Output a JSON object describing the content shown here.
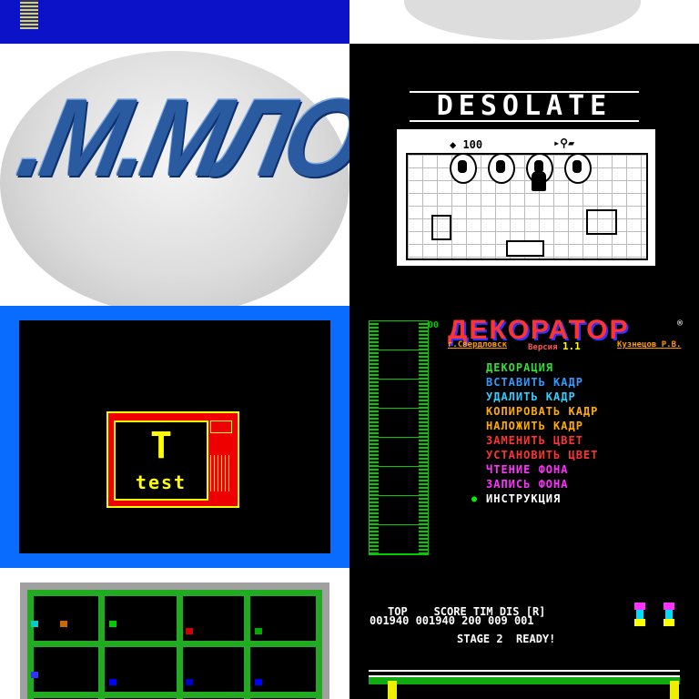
{
  "desolate": {
    "title": "DESOLATE",
    "hud_value": "100"
  },
  "tvtest": {
    "word": "test",
    "letter": "T"
  },
  "decorator": {
    "title": "ДЕКОРАТОР",
    "city": "г.Свердловск",
    "version_label": "Версия",
    "version": "1.1",
    "author": "Кузнецов Р.В.",
    "menu": [
      {
        "label": "ДЕКОРАЦИЯ",
        "color": "#33dd33"
      },
      {
        "label": "ВСТАВИТЬ КАДР",
        "color": "#3399ff"
      },
      {
        "label": "УДАЛИТЬ КАДР",
        "color": "#33ccff"
      },
      {
        "label": "КОПИРОВАТЬ КАДР",
        "color": "#ffaa00"
      },
      {
        "label": "НАЛОЖИТЬ КАДР",
        "color": "#ffaa00"
      },
      {
        "label": "ЗАМЕНИТЬ ЦВЕТ",
        "color": "#ff3333"
      },
      {
        "label": "УСТАНОВИТЬ ЦВЕТ",
        "color": "#ff3333"
      },
      {
        "label": "ЧТЕНИЕ ФОНА",
        "color": "#ff33ff"
      },
      {
        "label": "ЗАПИСЬ ФОНА",
        "color": "#ff33ff"
      },
      {
        "label": "ИНСТРУКЦИЯ",
        "color": "#ffffff"
      }
    ],
    "film_number": "00"
  },
  "stage": {
    "hud_headers": "TOP    SCORE TIM DIS [R]",
    "hud_values": "001940 001940 200 009 001",
    "status": "STAGE 2  READY!"
  },
  "colors": {
    "maze_wall": "#22aa22",
    "blue_bg": "#0a6cff"
  }
}
